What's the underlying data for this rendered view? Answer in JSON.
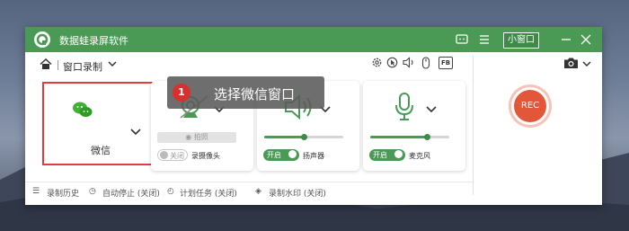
{
  "app": {
    "title": "数据蛙录屏软件",
    "mini_window_label": "小窗口"
  },
  "toolbar": {
    "mode_label": "窗口录制",
    "fb_label": "FB"
  },
  "callout": {
    "number": "1",
    "text": "选择微信窗口"
  },
  "cards": {
    "wechat": {
      "label": "微信"
    },
    "camera": {
      "capture_label": "拍照",
      "toggle_state": "关闭",
      "label": "录摄像头"
    },
    "speaker": {
      "toggle_state": "开启",
      "label": "扬声器",
      "level": 0.5
    },
    "mic": {
      "toggle_state": "开启",
      "label": "麦克风",
      "level": 0.72
    }
  },
  "rec": {
    "label": "REC"
  },
  "statusbar": {
    "history": "录制历史",
    "auto_stop": "自动停止 (关闭)",
    "schedule": "计划任务 (关闭)",
    "watermark": "录制水印 (关闭)"
  },
  "colors": {
    "brand_green": "#4a9a55",
    "rec_red": "#e2563a",
    "highlight_red": "#e03c3c"
  }
}
